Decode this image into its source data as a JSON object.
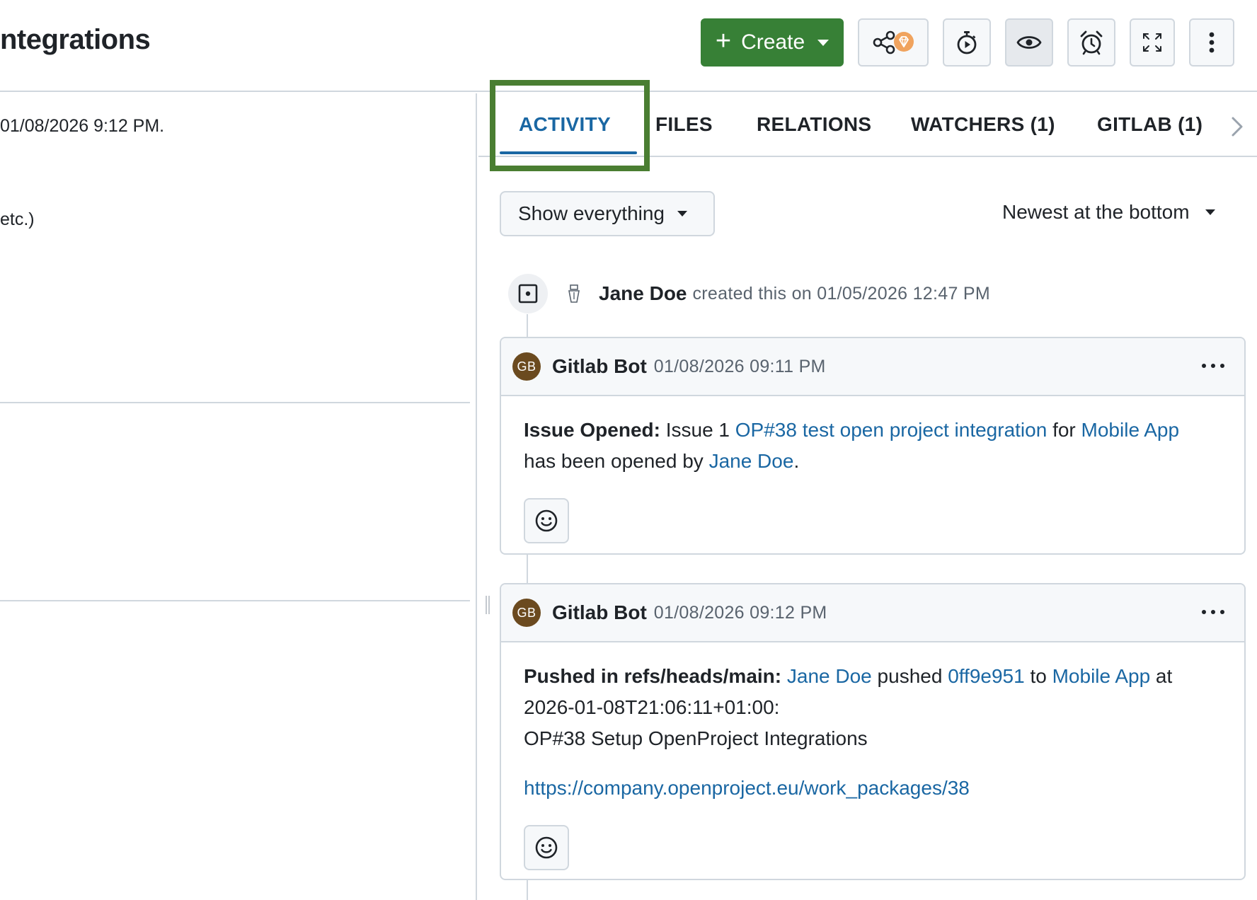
{
  "header": {
    "title": "ntegrations",
    "create_label": "Create"
  },
  "left_pane": {
    "line_1": "01/08/2026 9:12 PM.",
    "line_2": "etc.)"
  },
  "tabs": [
    {
      "label": "ACTIVITY",
      "active": true
    },
    {
      "label": "FILES"
    },
    {
      "label": "RELATIONS"
    },
    {
      "label": "WATCHERS (1)"
    },
    {
      "label": "GITLAB (1)"
    }
  ],
  "filters": {
    "show_label": "Show everything",
    "sort_label": "Newest at the bottom"
  },
  "activity": {
    "created": {
      "author": "Jane Doe",
      "text": "created this on 01/05/2026 12:47 PM"
    },
    "comments": [
      {
        "avatar": "GB",
        "author": "Gitlab Bot",
        "timestamp": "01/08/2026 09:11 PM",
        "heading": "Issue Opened:",
        "text_1": " Issue 1 ",
        "link_1": "OP#38 test open project integration",
        "text_2": " for ",
        "link_2": "Mobile App",
        "text_3": "has been opened by ",
        "link_3": "Jane Doe",
        "text_4": "."
      },
      {
        "avatar": "GB",
        "author": "Gitlab Bot",
        "timestamp": "01/08/2026 09:12 PM",
        "heading": "Pushed in refs/heads/main:",
        "link_1": "Jane Doe",
        "text_1": " pushed ",
        "link_2": "0ff9e951",
        "text_2": " to ",
        "link_3": "Mobile App",
        "text_3": " at",
        "line_2": "2026-01-08T21:06:11+01:00:",
        "line_3": "OP#38 Setup OpenProject Integrations",
        "url": "https://company.openproject.eu/work_packages/38"
      }
    ]
  },
  "colors": {
    "create_green": "#378036",
    "link_blue": "#1a67a3",
    "focus_ring": "#4a7e32",
    "avatar_brown": "#6b4a1f",
    "premium_badge": "#f0a35e"
  },
  "icons": [
    "plus-icon",
    "share-icon",
    "premium-badge-icon",
    "timer-icon",
    "eye-icon",
    "alarm-icon",
    "fullscreen-icon",
    "more-vertical-icon",
    "chevron-right-icon",
    "work-package-icon",
    "emoji-icon",
    "ellipsis-icon"
  ]
}
